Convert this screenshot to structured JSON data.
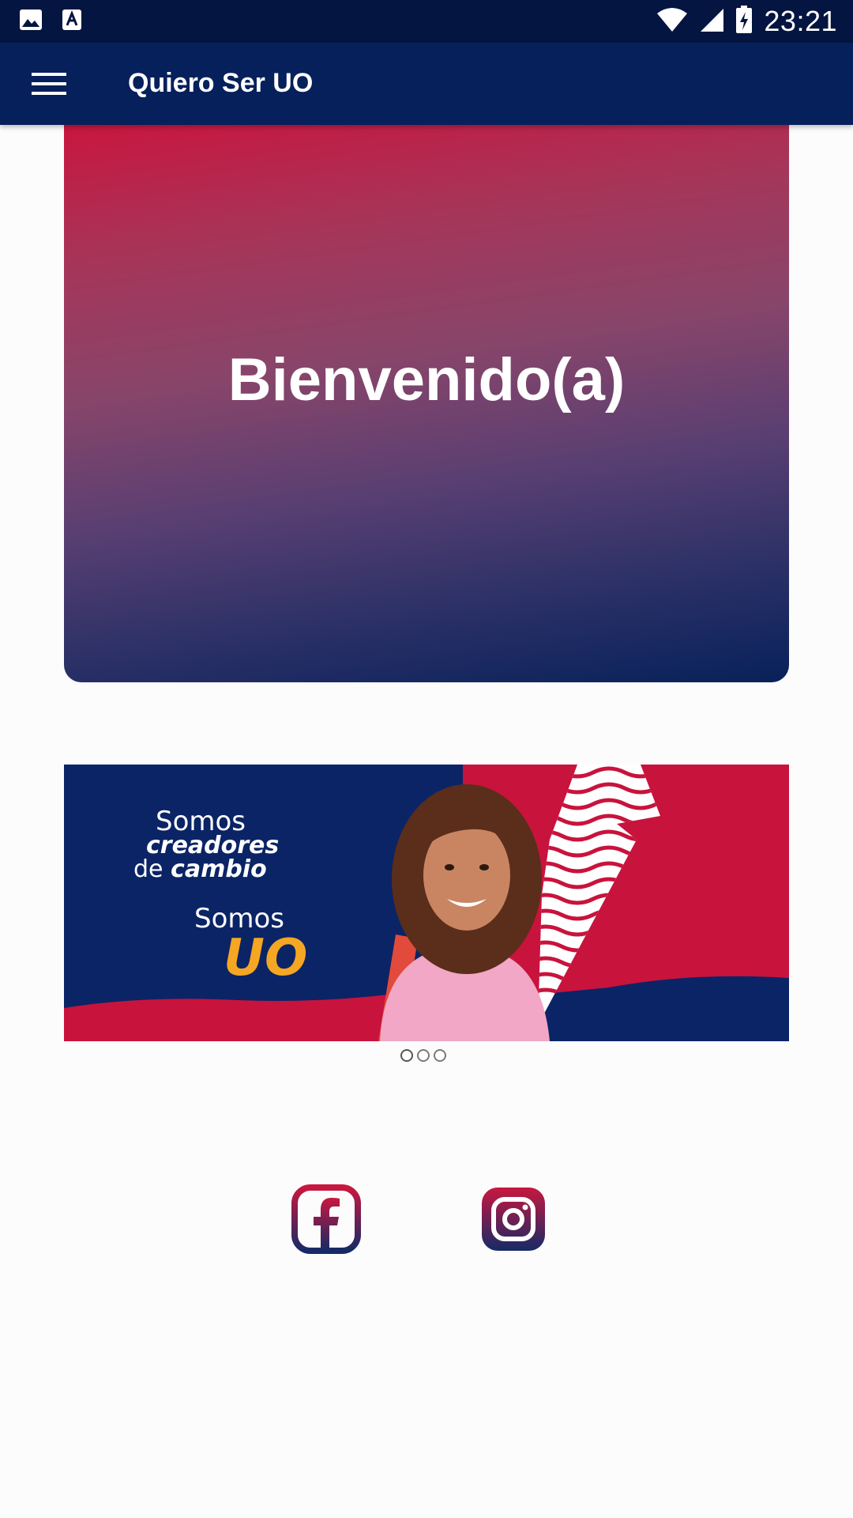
{
  "status_bar": {
    "time": "23:21",
    "icons": [
      "image-icon",
      "text-a-icon",
      "wifi-icon",
      "signal-icon",
      "battery-charging-icon"
    ]
  },
  "app_bar": {
    "title": "Quiero Ser UO",
    "menu_icon": "menu-icon"
  },
  "welcome": {
    "text": "Bienvenido(a)"
  },
  "banner": {
    "line1": "Somos",
    "line2": "creadores",
    "line3_prefix": "de ",
    "line3_emphasis": "cambio",
    "line4": "Somos",
    "line5": "UO",
    "colors": {
      "navy": "#0b2466",
      "red": "#c8133d",
      "accent": "#f5a623"
    }
  },
  "carousel": {
    "slide_count": 3
  },
  "social": [
    {
      "name": "facebook",
      "icon": "facebook-icon"
    },
    {
      "name": "instagram",
      "icon": "instagram-icon"
    }
  ],
  "theme": {
    "primary": "#06205c",
    "status_bar": "#031540",
    "gradient_top": "#c9163f",
    "gradient_bottom": "#08215a"
  }
}
